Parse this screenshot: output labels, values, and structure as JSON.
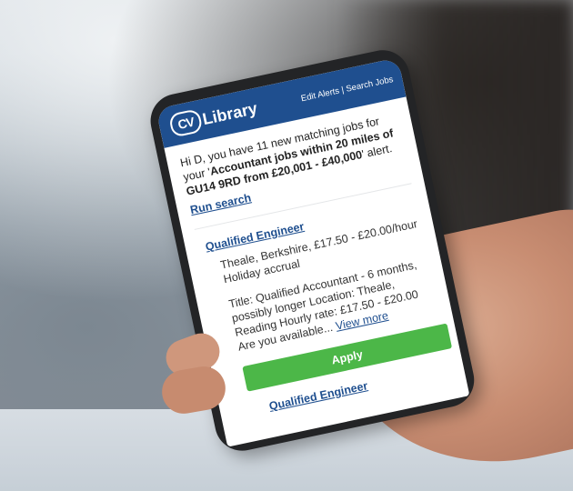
{
  "app": {
    "logo_cv": "CV",
    "logo_word": "Library",
    "edit_alerts": "Edit Alerts",
    "nav_separator": " | ",
    "search_jobs": "Search Jobs"
  },
  "email": {
    "intro_prefix": "Hi D, you have 11 new matching jobs for your '",
    "alert_name": "Accountant jobs within 20 miles of GU14 9RD from £20,001 - £40,000",
    "intro_suffix": "' alert.",
    "run_search": "Run search"
  },
  "jobs": [
    {
      "title": "Qualified Engineer",
      "meta": "Theale, Berkshire, £17.50 - £20.00/hour Holiday accrual",
      "description": "Title: Qualified Accountant - 6 months, possibly longer Location: Theale, Reading Hourly rate: £17.50 - £20.00 Are you available...",
      "view_more": "View more",
      "apply": "Apply"
    },
    {
      "title": "Qualified Engineer"
    }
  ],
  "colors": {
    "header": "#1f4f8f",
    "link": "#1f4f8f",
    "apply": "#4cb748"
  }
}
